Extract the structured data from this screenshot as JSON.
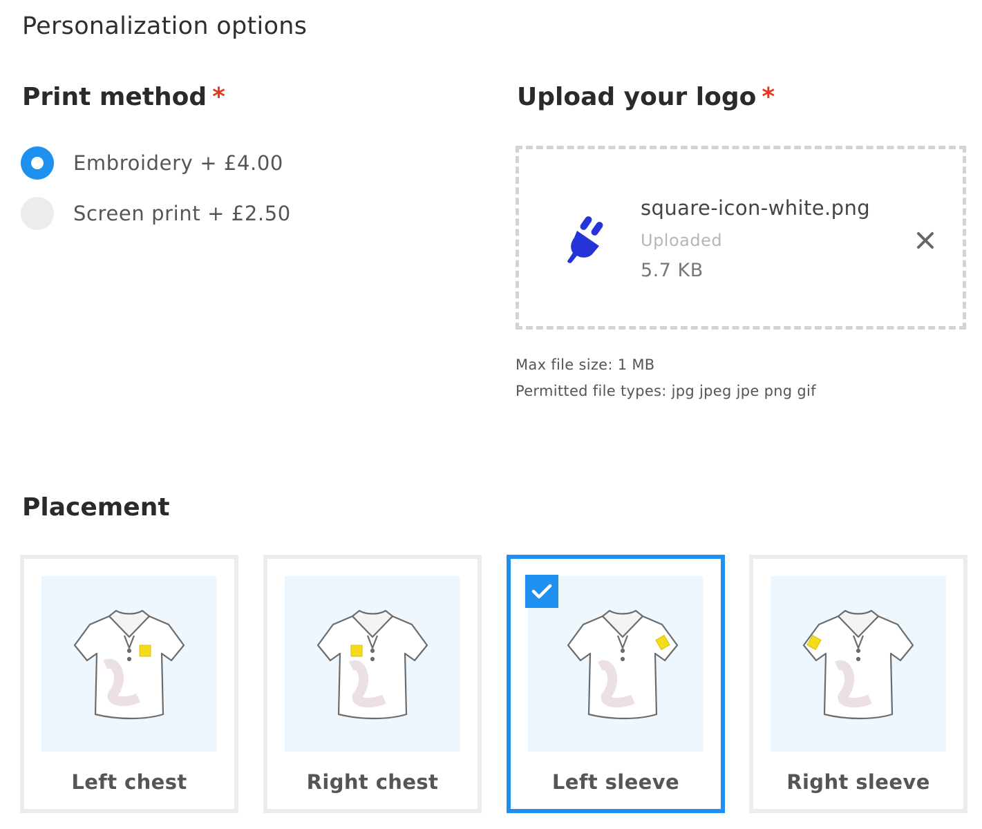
{
  "page_title": "Personalization options",
  "print_method": {
    "title": "Print method",
    "required_mark": "*",
    "options": [
      {
        "label": "Embroidery + £4.00",
        "selected": true
      },
      {
        "label": "Screen print + £2.50",
        "selected": false
      }
    ]
  },
  "upload": {
    "title": "Upload your logo",
    "required_mark": "*",
    "file": {
      "name": "square-icon-white.png",
      "status": "Uploaded",
      "size": "5.7 KB",
      "icon": "plug-icon"
    },
    "hints": [
      "Max file size: 1 MB",
      "Permitted file types: jpg jpeg jpe png gif"
    ]
  },
  "placement": {
    "title": "Placement",
    "options": [
      {
        "label": "Left chest",
        "selected": false
      },
      {
        "label": "Right chest",
        "selected": false
      },
      {
        "label": "Left sleeve",
        "selected": true
      },
      {
        "label": "Right sleeve",
        "selected": false
      }
    ]
  },
  "colors": {
    "accent": "#1e90f0",
    "required": "#e03a25",
    "logo_marker": "#f3dc1b",
    "plug_icon": "#2633d6"
  }
}
